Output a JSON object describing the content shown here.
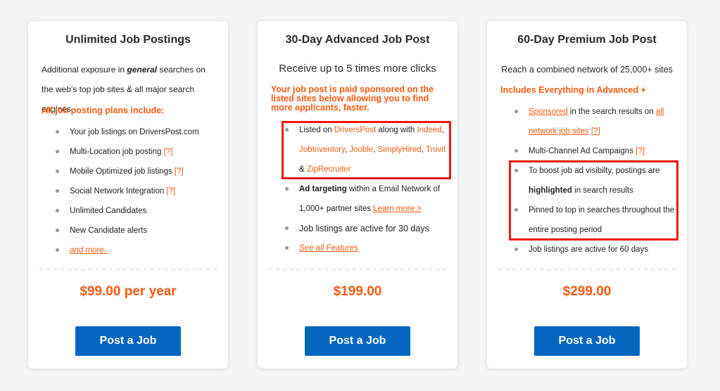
{
  "colors": {
    "accent_orange": "#fb5b12",
    "button_blue": "#0566c0",
    "highlight_red": "#f0190a",
    "page_bg": "#f5f5f5"
  },
  "plans": [
    {
      "title": "Unlimited Job Postings",
      "desc_part1": "Additional exposure in ",
      "desc_em": "general",
      "desc_part2": " searches on the web's top job sites & all major search engines",
      "orange_heading": "All job posting plans include:",
      "features": [
        {
          "text": "Your job listings on DriversPost.com"
        },
        {
          "text": "Multi-Location job posting ",
          "help": "[?]"
        },
        {
          "text": "Mobile Optimized job listings ",
          "help": "[?]"
        },
        {
          "text": "Social Network Integration ",
          "help": "[?]"
        },
        {
          "text": "Unlimited Candidates"
        },
        {
          "text": "New Candidate alerts"
        },
        {
          "link": "and more.."
        }
      ],
      "price": "$99.00 per year",
      "button": "Post a Job"
    },
    {
      "title": "30-Day Advanced Job Post",
      "subtitle": "Receive up to 5 times more clicks",
      "orange_heading": "Your job post is paid sponsored on the listed sites below allowing you to find more applicants, faster.",
      "features": {
        "listed": {
          "prefix": "Listed on ",
          "sites": [
            "DriversPost",
            "Indeed",
            "JobInventory",
            "Jooble",
            "SimplyHired",
            "Trovit",
            "ZipRecruiter"
          ],
          "along_with": " along with ",
          "amp": "& "
        },
        "ad_targeting": {
          "bold": "Ad targeting",
          "text": " within a Email Network of 1,000+ partner sites ",
          "link": "Learn more >"
        },
        "active": "Job listings are active for 30 days",
        "see_all": "See all Features"
      },
      "price": "$199.00",
      "button": "Post a Job"
    },
    {
      "title": "60-Day Premium Job Post",
      "subtitle": "Reach a combined network of 25,000+ sites",
      "orange_heading": "Includes Everything in Advanced +",
      "features": {
        "sponsored": {
          "link": "Sponsored",
          "text": " in the search results on ",
          "link2": "all network job sites",
          "help": "[?]"
        },
        "multichannel": {
          "text": "Multi-Channel Ad Campaigns ",
          "help": "[?]"
        },
        "boost": {
          "text1": "To boost job ad visibilty, postings are ",
          "bold": "highlighted",
          "text2": " in search results"
        },
        "pinned": "Pinned to top in searches throughout the entire posting period",
        "active": "Job listings are active for 60 days"
      },
      "price": "$299.00",
      "button": "Post a Job"
    }
  ]
}
